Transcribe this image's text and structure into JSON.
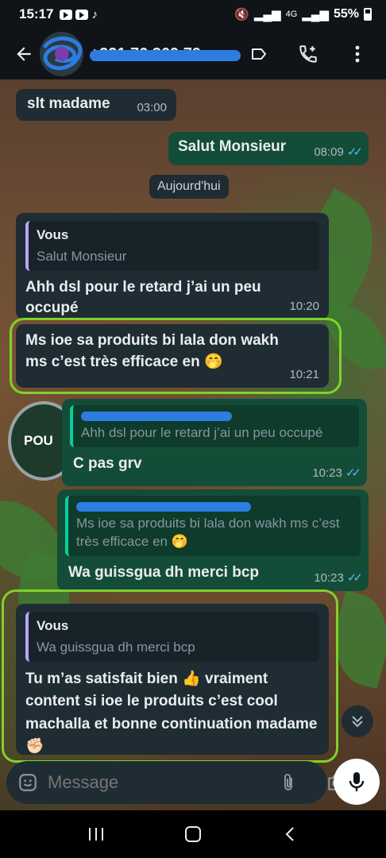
{
  "status": {
    "time": "15:17",
    "battery": "55%",
    "network": "4G"
  },
  "header": {
    "contact_name": "+221 76 369 79..."
  },
  "date_chip": "Aujourd'hui",
  "messages": [
    {
      "text": "slt madame",
      "time": "03:00"
    },
    {
      "text": "Salut Monsieur",
      "time": "08:09"
    },
    {
      "quote_author": "Vous",
      "quote_text": "Salut Monsieur",
      "text": "Ahh dsl pour le retard j’ai un peu occupé",
      "time": "10:20"
    },
    {
      "text": "Ms ioe sa produits bi lala don wakh ms c’est très efficace en 🤭",
      "time": "10:21"
    },
    {
      "quote_text": "Ahh dsl pour le retard j’ai un peu occupé",
      "text": "C pas grv",
      "time": "10:23"
    },
    {
      "quote_text": "Ms ioe sa produits bi lala don wakh ms c’est très efficace en 🤭",
      "text": "Wa guissgua dh merci bcp",
      "time": "10:23"
    },
    {
      "quote_author": "Vous",
      "quote_text": "Wa guissgua dh merci bcp",
      "text": "Tu m’as satisfait bien 👍 vraiment content si ioe le produits c’est cool machalla et bonne continuation madame ✊🏻"
    }
  ],
  "composer": {
    "placeholder": "Message"
  },
  "background_text": "POU",
  "colors": {
    "incoming": "#1f2c33",
    "outgoing": "#144d37",
    "read_ticks": "#53bdeb",
    "highlight": "#7fd22a",
    "accent_bar": "#06cf9c"
  }
}
